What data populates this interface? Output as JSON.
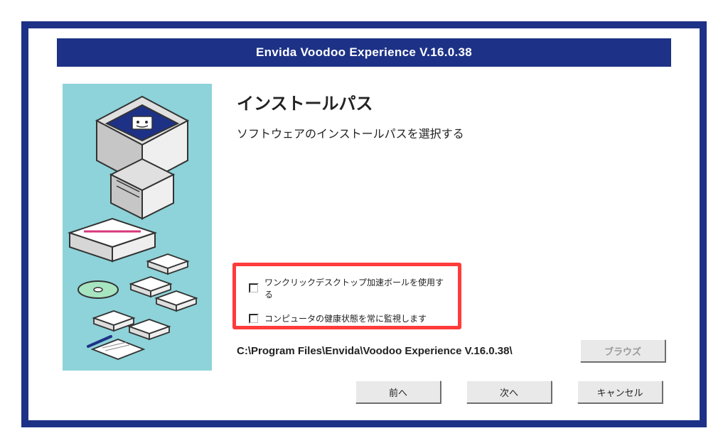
{
  "title": "Envida Voodoo Experience V.16.0.38",
  "page": {
    "heading": "インストールパス",
    "subtitle": "ソフトウェアのインストールパスを選択する"
  },
  "options": {
    "opt1_label": "ワンクリックデスクトップ加速ボールを使用する",
    "opt2_label": "コンピュータの健康状態を常に監視します"
  },
  "install_path": "C:\\Program Files\\Envida\\Voodoo Experience V.16.0.38\\",
  "buttons": {
    "browse": "ブラウズ",
    "back": "前へ",
    "next": "次へ",
    "cancel": "キャンセル"
  },
  "colors": {
    "frame": "#1d3286",
    "sidebar_bg": "#8dd3d9",
    "highlight": "#ff3b3b"
  }
}
